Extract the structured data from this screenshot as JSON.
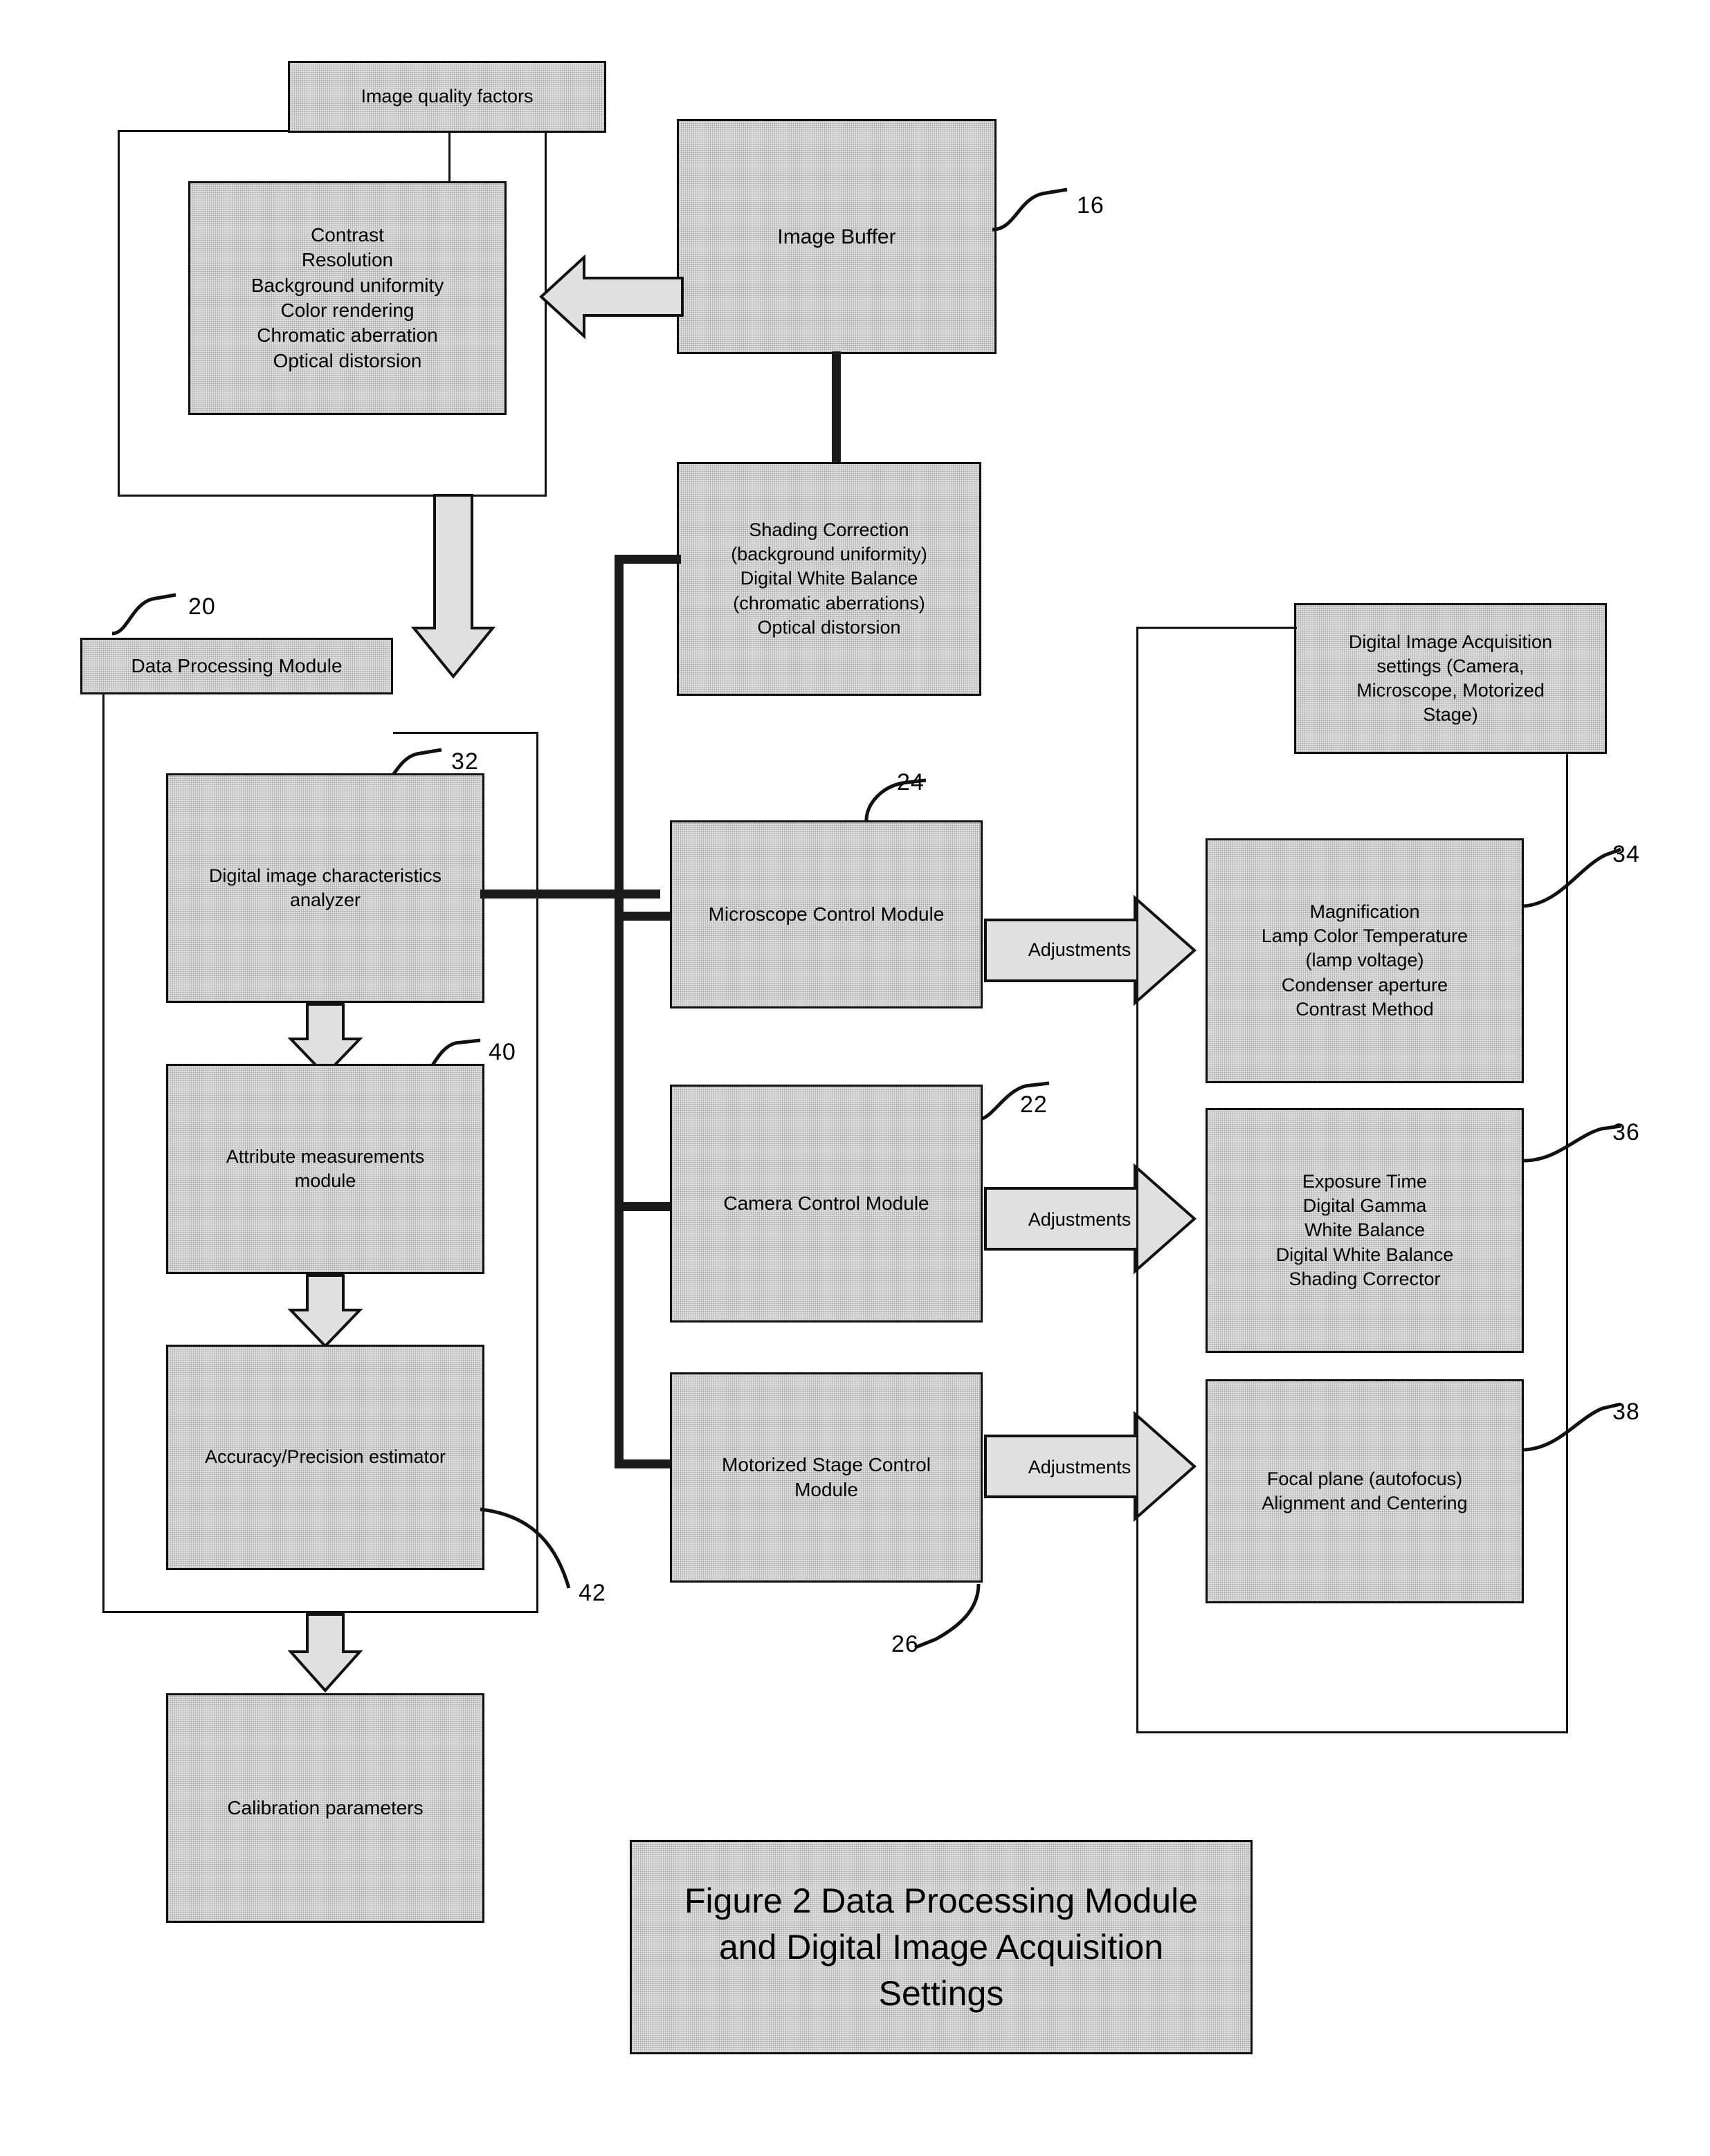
{
  "figure": {
    "caption": "Figure 2 Data Processing Module\nand Digital Image Acquisition\nSettings"
  },
  "nodes": {
    "image_quality_factors": {
      "label": "Image quality factors"
    },
    "quality_list": {
      "label": "Contrast\nResolution\nBackground uniformity\nColor rendering\nChromatic aberration\nOptical distorsion"
    },
    "image_buffer": {
      "label": "Image Buffer",
      "ref": "16"
    },
    "shading_correction": {
      "label": "Shading Correction\n(background uniformity)\nDigital White Balance\n(chromatic aberrations)\nOptical distorsion"
    },
    "data_processing_module": {
      "label": "Data Processing Module",
      "ref": "20"
    },
    "digital_image_characteristics_analyzer": {
      "label": "Digital image characteristics\nanalyzer",
      "ref": "32"
    },
    "attribute_measurements_module": {
      "label": "Attribute measurements\nmodule",
      "ref": "40"
    },
    "accuracy_precision_estimator": {
      "label": "Accuracy/Precision estimator",
      "ref": "42"
    },
    "calibration_parameters": {
      "label": "Calibration parameters"
    },
    "microscope_control_module": {
      "label": "Microscope Control Module",
      "ref": "24"
    },
    "camera_control_module": {
      "label": "Camera Control Module",
      "ref": "22"
    },
    "motorized_stage_control_module": {
      "label": "Motorized Stage Control\nModule",
      "ref": "26"
    },
    "digital_image_acquisition_settings": {
      "label": "Digital Image Acquisition\nsettings (Camera,\nMicroscope, Motorized\nStage)"
    },
    "microscope_settings": {
      "label": "Magnification\nLamp Color Temperature\n(lamp voltage)\nCondenser aperture\nContrast Method",
      "ref": "34"
    },
    "camera_settings": {
      "label": "Exposure Time\nDigital Gamma\nWhite Balance\nDigital White Balance\nShading Corrector",
      "ref": "36"
    },
    "stage_settings": {
      "label": "Focal plane (autofocus)\nAlignment and Centering",
      "ref": "38"
    }
  },
  "arrows": {
    "adjustments_microscope": "Adjustments",
    "adjustments_camera": "Adjustments",
    "adjustments_stage": "Adjustments"
  },
  "colors": {
    "box_fill": "#e0e0e0",
    "line": "#111111",
    "page": "#ffffff"
  }
}
